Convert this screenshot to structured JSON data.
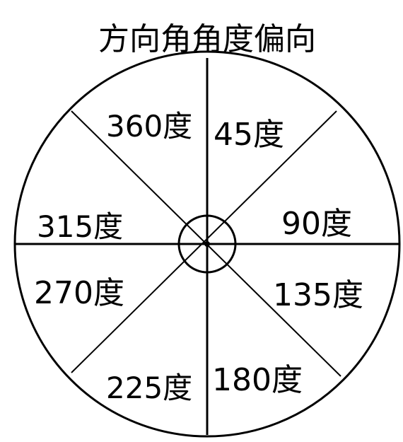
{
  "title": "方向角角度偏向",
  "labels": {
    "deg_360": "360度",
    "deg_45": "45度",
    "deg_315": "315度",
    "deg_90": "90度",
    "deg_270": "270度",
    "deg_135": "135度",
    "deg_225": "225度",
    "deg_180": "180度"
  },
  "colors": {
    "line": "#000000",
    "text": "#000000",
    "background": "#ffffff"
  }
}
